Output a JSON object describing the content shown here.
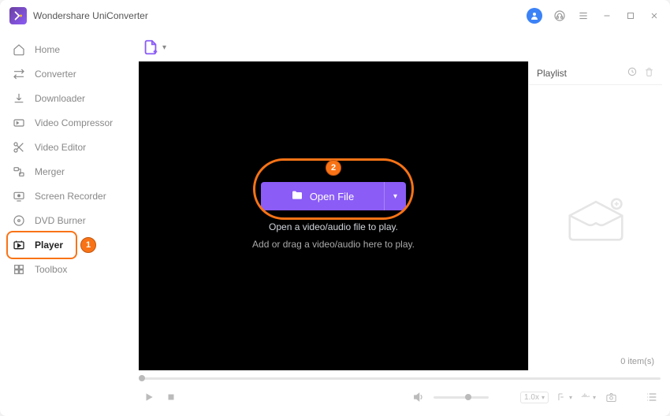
{
  "app": {
    "title": "Wondershare UniConverter"
  },
  "sidebar": {
    "items": [
      {
        "label": "Home"
      },
      {
        "label": "Converter"
      },
      {
        "label": "Downloader"
      },
      {
        "label": "Video Compressor"
      },
      {
        "label": "Video Editor"
      },
      {
        "label": "Merger"
      },
      {
        "label": "Screen Recorder"
      },
      {
        "label": "DVD Burner"
      },
      {
        "label": "Player"
      },
      {
        "label": "Toolbox"
      }
    ]
  },
  "player": {
    "open_file_label": "Open File",
    "hint_bold": "Open a video/audio file to play.",
    "hint_sub": "Add or drag a video/audio here to play.",
    "playlist_title": "Playlist",
    "playlist_count": "0 item(s)",
    "speed": "1.0x"
  },
  "annotations": {
    "step1": "1",
    "step2": "2"
  }
}
